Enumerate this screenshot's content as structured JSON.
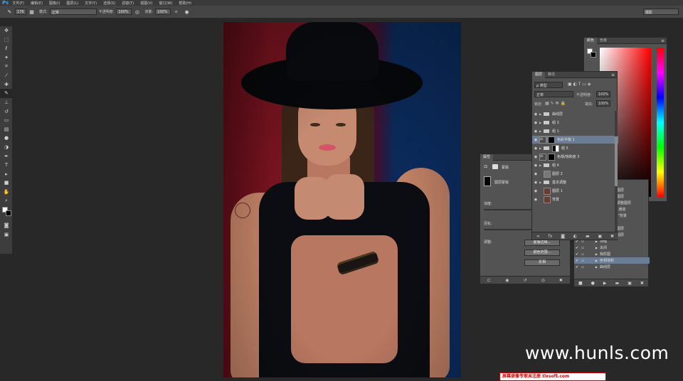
{
  "app": {
    "logo": "Ps"
  },
  "menu": [
    "文件(F)",
    "编辑(E)",
    "图像(I)",
    "图层(L)",
    "文字(Y)",
    "选择(S)",
    "滤镜(T)",
    "视图(V)",
    "窗口(W)",
    "帮助(H)"
  ],
  "options": {
    "brush_size": "176",
    "mode_label": "模式:",
    "mode_value": "正常",
    "opacity_label": "不透明度:",
    "opacity_value": "100%",
    "flow_label": "流量:",
    "flow_value": "100%",
    "workspace": "摄影"
  },
  "color_panel": {
    "tabs": [
      "颜色",
      "色板"
    ]
  },
  "layers": {
    "tabs": [
      "图层",
      "路径"
    ],
    "kind": "ρ 类型",
    "blend": "正常",
    "opacity_label": "不透明度:",
    "opacity_value": "100%",
    "lock_label": "锁定:",
    "fill_label": "填充:",
    "fill_value": "100%",
    "rows": [
      {
        "name": "曲线层",
        "type": "group"
      },
      {
        "name": "组 3",
        "type": "group"
      },
      {
        "name": "组 1",
        "type": "group"
      },
      {
        "name": "色彩平衡 1",
        "type": "adjust",
        "selected": true
      },
      {
        "name": "组 5",
        "type": "group-mask"
      },
      {
        "name": "色相/饱和度 3",
        "type": "adjust"
      },
      {
        "name": "组 4",
        "type": "group"
      },
      {
        "name": "图层 2",
        "type": "layer"
      },
      {
        "name": "基本调整",
        "type": "group"
      },
      {
        "name": "图层 1",
        "type": "photo"
      },
      {
        "name": "背景",
        "type": "photo"
      }
    ],
    "footer_icons": [
      "link-icon",
      "fx-icon",
      "mask-icon",
      "adjustment-icon",
      "folder-icon",
      "new-layer-icon",
      "trash-icon"
    ]
  },
  "properties": {
    "tab": "属性",
    "header": "蒙版",
    "mask_label": "图层蒙版",
    "density_label": "浓度:",
    "feather_label": "羽化:",
    "refine_label": "调整:",
    "btn_edge": "蒙版边缘...",
    "btn_color": "颜色范围...",
    "btn_invert": "反相"
  },
  "actions": {
    "rows": [
      {
        "name": "调整图层",
        "sel": false
      },
      {
        "name": "调整图层",
        "sel": false
      },
      {
        "name": "当前调整图层",
        "sel": false
      },
      {
        "name": "RGB 通道",
        "sel": false
      },
      {
        "name": "图层 \"背景",
        "sel": false
      },
      {
        "name": "编组",
        "sel": false
      },
      {
        "name": "调整图层",
        "sel": false
      },
      {
        "name": "当前图层",
        "sel": false
      },
      {
        "name": "存储",
        "sel": false
      },
      {
        "name": "关闭",
        "sel": false
      },
      {
        "name": "我原图",
        "sel": false
      },
      {
        "name": "色相饱和",
        "sel": true
      },
      {
        "name": "曲线层",
        "sel": false
      }
    ]
  },
  "overlay": {
    "watermark": "www.hunls.com",
    "registration": "屏幕录像专家未注册 tlxsoft.com"
  }
}
